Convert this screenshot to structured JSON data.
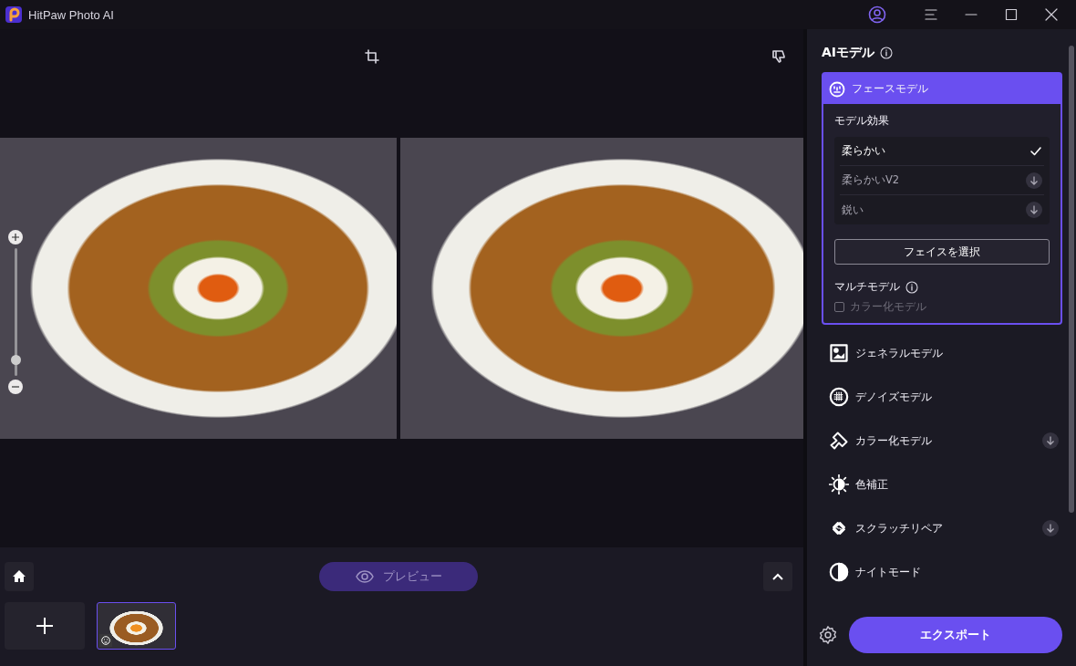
{
  "app": {
    "title": "HitPaw Photo AI"
  },
  "canvas": {
    "zoom": {
      "level": 0.12
    }
  },
  "bottom_bar": {
    "preview": {
      "label": "プレビュー",
      "disabled": true
    },
    "thumbnails": [
      {
        "selected": true
      }
    ]
  },
  "panel": {
    "title": "AIモデル",
    "models": [
      {
        "label": "フェースモデル",
        "selected": true,
        "downloaded": true,
        "effects_title": "モデル効果",
        "effects": [
          {
            "label": "柔らかい",
            "selected": true,
            "downloaded": true
          },
          {
            "label": "柔らかいV2",
            "selected": false,
            "downloaded": false
          },
          {
            "label": "鋭い",
            "selected": false,
            "downloaded": false
          }
        ],
        "select_button": "フェイスを選択",
        "multi_title": "マルチモデル",
        "multi_options": [
          {
            "label": "カラー化モデル",
            "checked": false,
            "disabled": true
          }
        ]
      },
      {
        "label": "ジェネラルモデル",
        "selected": false,
        "downloaded": true
      },
      {
        "label": "デノイズモデル",
        "selected": false,
        "downloaded": true
      },
      {
        "label": "カラー化モデル",
        "selected": false,
        "downloaded": false
      },
      {
        "label": "色補正",
        "selected": false,
        "downloaded": true
      },
      {
        "label": "スクラッチリペア",
        "selected": false,
        "downloaded": false
      },
      {
        "label": "ナイトモード",
        "selected": false,
        "downloaded": true
      }
    ],
    "export": "エクスポート"
  }
}
